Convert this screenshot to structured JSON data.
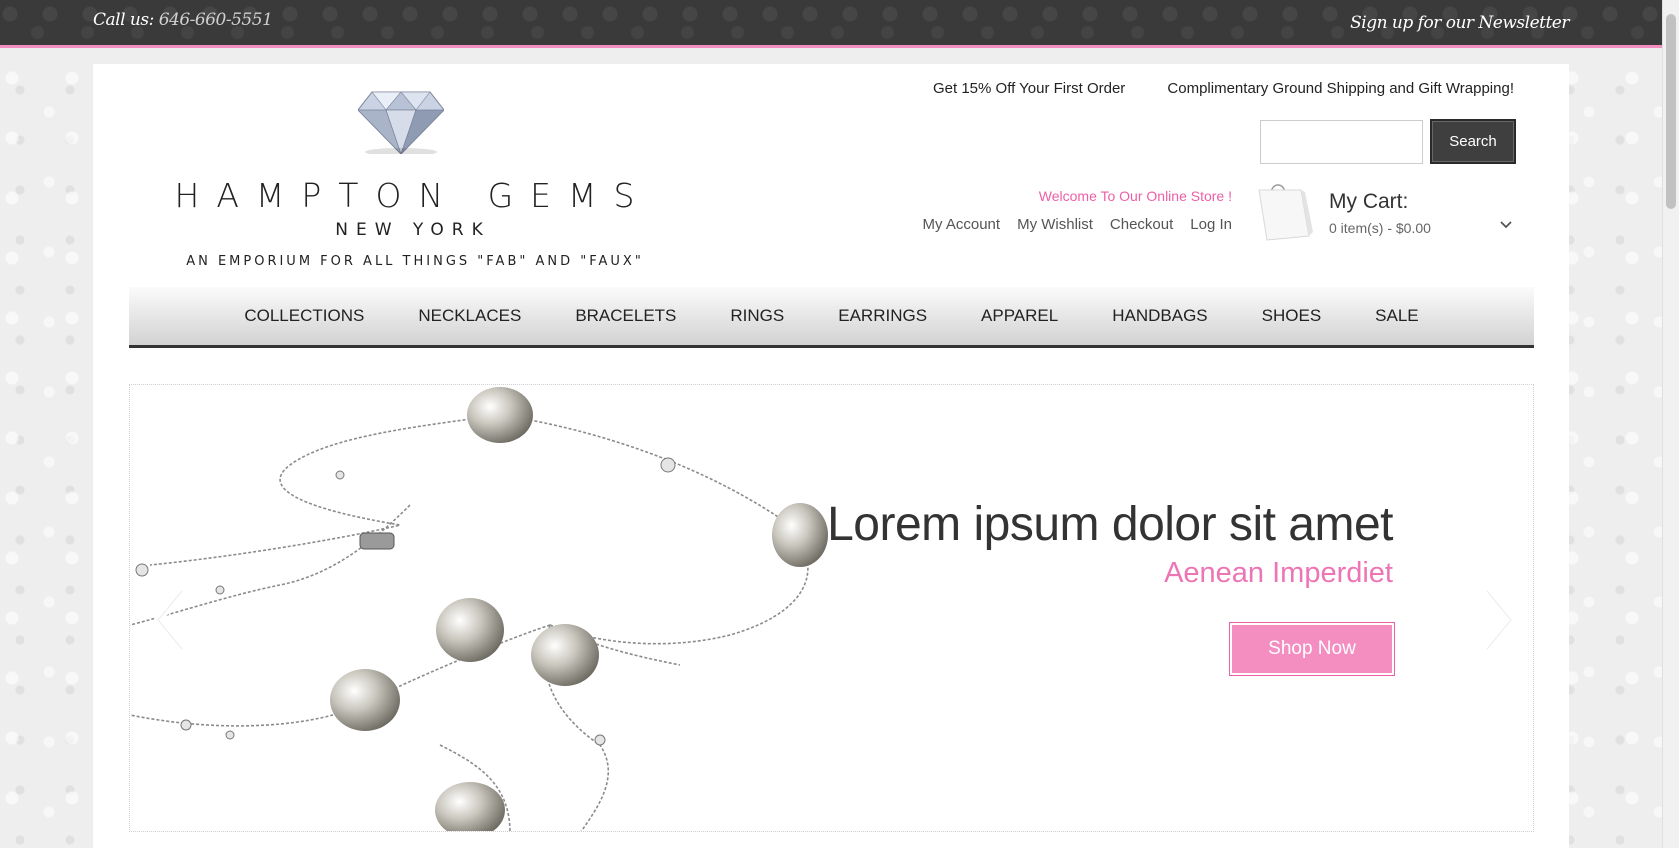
{
  "topbar": {
    "call_label": "Call us:",
    "phone": "646-660-5551",
    "newsletter": "Sign up for our Newsletter"
  },
  "logo": {
    "brand": "HAMPTON GEMS",
    "city": "NEW YORK",
    "tagline": "AN EMPORIUM FOR ALL THINGS \"FAB\" AND \"FAUX\""
  },
  "header": {
    "promo_first_order": "Get 15% Off Your First Order",
    "promo_shipping": "Complimentary Ground Shipping and Gift Wrapping!",
    "search_value": "",
    "search_button": "Search",
    "welcome": "Welcome To Our Online Store !",
    "links": [
      "My Account",
      "My Wishlist",
      "Checkout",
      "Log In"
    ],
    "cart_title": "My Cart:",
    "cart_summary": "0 item(s) - $0.00"
  },
  "nav": {
    "items": [
      "COLLECTIONS",
      "NECKLACES",
      "BRACELETS",
      "RINGS",
      "EARRINGS",
      "APPAREL",
      "HANDBAGS",
      "SHOES",
      "SALE"
    ]
  },
  "slider": {
    "headline": "Lorem ipsum dolor sit amet",
    "subhead": "Aenean Imperdiet",
    "cta": "Shop Now"
  },
  "colors": {
    "accent_pink": "#f48ec1",
    "dark_bar": "#3a3a3a"
  },
  "icons": [
    "diamond-logo-icon",
    "shopping-bag-icon",
    "chevron-down-icon",
    "arrow-left-icon",
    "arrow-right-icon"
  ]
}
